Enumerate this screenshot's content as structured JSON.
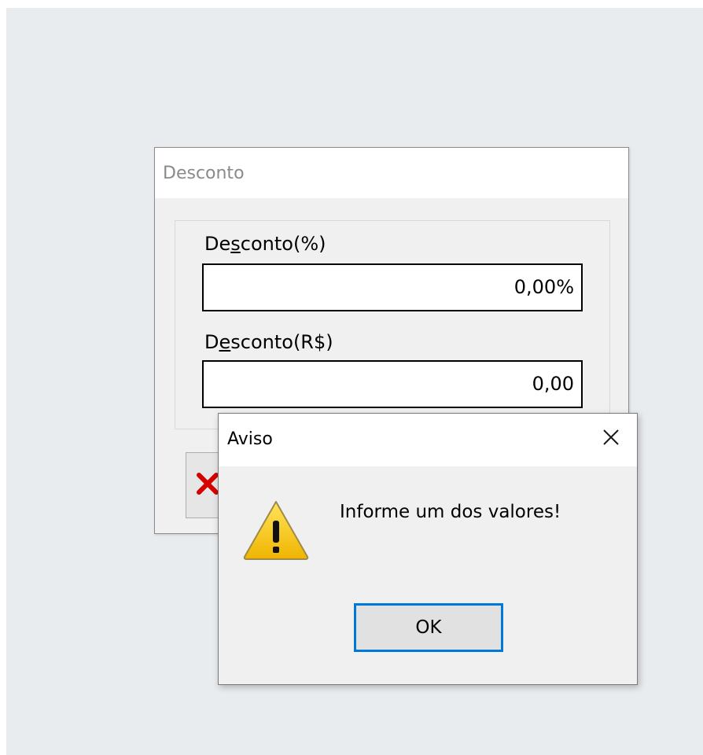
{
  "desconto_window": {
    "title": "Desconto",
    "percent_field": {
      "label_pre": "De",
      "label_acc": "s",
      "label_post": "conto(%)",
      "value": "0,00%"
    },
    "amount_field": {
      "label_pre": "D",
      "label_acc": "e",
      "label_post": "sconto(R$)",
      "value": "0,00"
    },
    "cancel_button": {
      "icon": "red-x-icon"
    }
  },
  "aviso_dialog": {
    "title": "Aviso",
    "close_icon": "close-icon",
    "warning_icon": "warning-icon",
    "message": "Informe um dos valores!",
    "ok_label": "OK"
  },
  "colors": {
    "accent": "#0078d7",
    "cancel_red": "#d40000",
    "warning_yellow": "#f5c400"
  }
}
